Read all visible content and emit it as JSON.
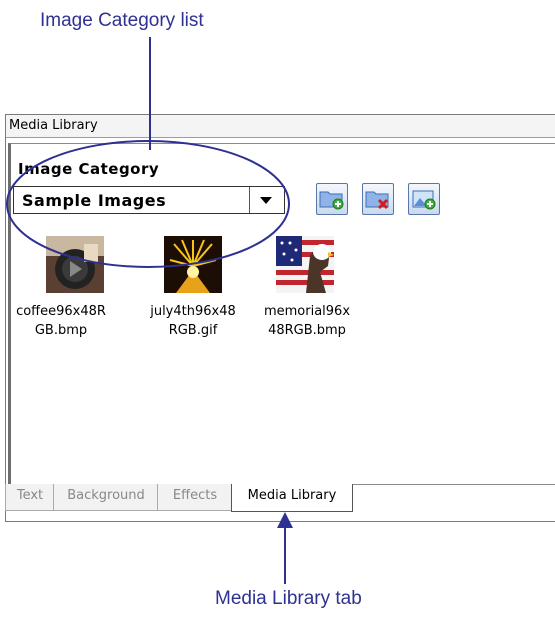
{
  "callouts": {
    "top": "Image Category list",
    "bottom": "Media Library tab"
  },
  "panel": {
    "title": "Media Library",
    "category_label": "Image Category",
    "category_value": "Sample Images",
    "toolbar": {
      "add_folder_icon": "folder-add-icon",
      "delete_folder_icon": "folder-delete-icon",
      "add_image_icon": "image-add-icon"
    }
  },
  "images": [
    {
      "line1": "coffee96x48R",
      "line2": "GB.bmp"
    },
    {
      "line1": "july4th96x48",
      "line2": "RGB.gif"
    },
    {
      "line1": "memorial96x",
      "line2": "48RGB.bmp"
    }
  ],
  "tabs": [
    {
      "label": "Text"
    },
    {
      "label": "Background"
    },
    {
      "label": "Effects"
    },
    {
      "label": "Media Library"
    }
  ],
  "colors": {
    "annotation": "#2e3192"
  }
}
